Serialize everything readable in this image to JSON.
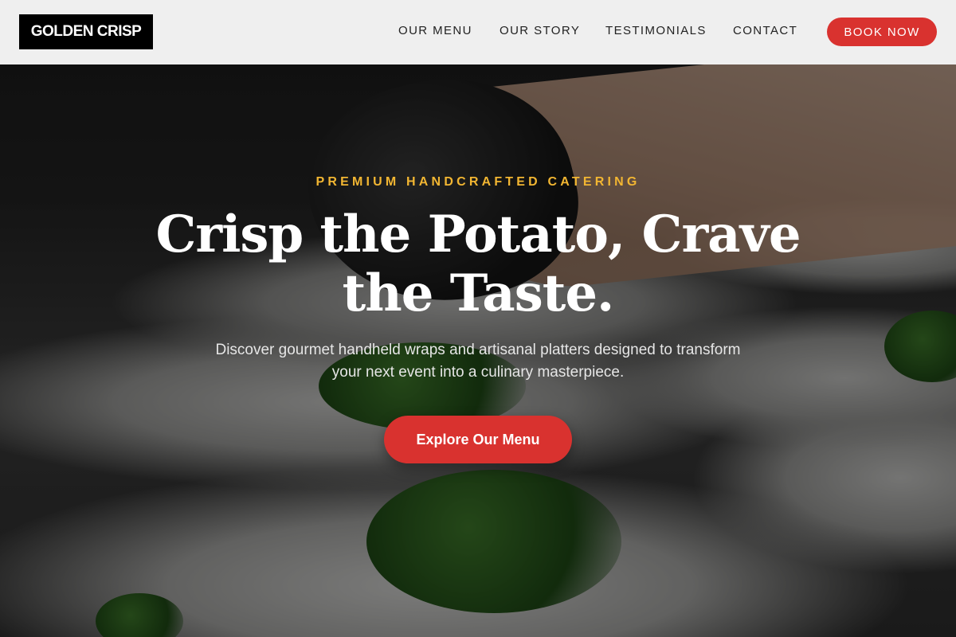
{
  "header": {
    "logo_text": "GOLDEN CRISP",
    "nav": [
      {
        "label": "OUR MENU"
      },
      {
        "label": "OUR STORY"
      },
      {
        "label": "TESTIMONIALS"
      },
      {
        "label": "CONTACT"
      }
    ],
    "cta_label": "BOOK NOW"
  },
  "hero": {
    "eyebrow": "PREMIUM HANDCRAFTED CATERING",
    "headline": "Crisp the Potato, Crave the Taste.",
    "subtext": "Discover gourmet handheld wraps and artisanal platters designed to transform your next event into a culinary masterpiece.",
    "cta_label": "Explore Our Menu",
    "background_image": "chef plating food on white plates"
  },
  "colors": {
    "accent_red": "#d9322f",
    "eyebrow_gold": "#f2b632",
    "header_bg": "#efefef",
    "logo_bg": "#000000"
  }
}
